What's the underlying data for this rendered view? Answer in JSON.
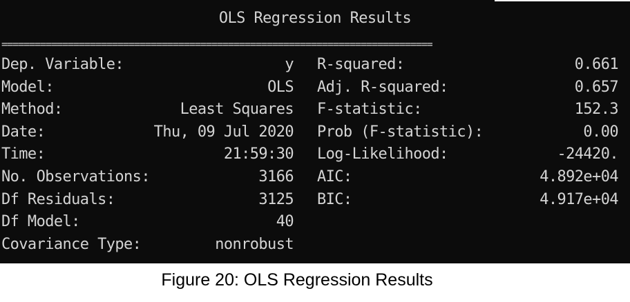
{
  "terminal": {
    "title": "OLS Regression Results",
    "separator": "==============================================================================",
    "rows": [
      {
        "label": "Dep. Variable:",
        "value": "y",
        "label2": "R-squared:",
        "value2": "0.661"
      },
      {
        "label": "Model:",
        "value": "OLS",
        "label2": "Adj. R-squared:",
        "value2": "0.657"
      },
      {
        "label": "Method:",
        "value": "Least Squares",
        "label2": "F-statistic:",
        "value2": "152.3"
      },
      {
        "label": "Date:",
        "value": "Thu, 09 Jul 2020",
        "label2": "Prob (F-statistic):",
        "value2": "0.00"
      },
      {
        "label": "Time:",
        "value": "21:59:30",
        "label2": "Log-Likelihood:",
        "value2": "-24420."
      },
      {
        "label": "No. Observations:",
        "value": "3166",
        "label2": "AIC:",
        "value2": "4.892e+04"
      },
      {
        "label": "Df Residuals:",
        "value": "3125",
        "label2": "BIC:",
        "value2": "4.917e+04"
      },
      {
        "label": "Df Model:",
        "value": "40",
        "label2": "",
        "value2": ""
      },
      {
        "label": "Covariance Type:",
        "value": "nonrobust",
        "label2": "",
        "value2": ""
      }
    ]
  },
  "caption": "Figure 20: OLS Regression Results",
  "colors": {
    "terminal_background": "#0c0c0c",
    "terminal_text": "#d4d4d4",
    "caption_text": "#000000"
  }
}
